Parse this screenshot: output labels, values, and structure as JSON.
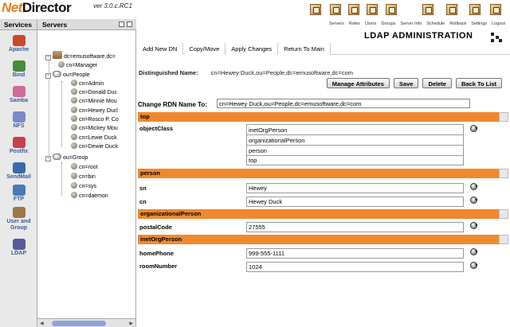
{
  "app": {
    "logo_prefix": "Net",
    "logo_suffix": "Director",
    "version": "ver 3.0.c.RC1"
  },
  "topnav": [
    "Servers",
    "Roles",
    "Users",
    "Groups",
    "Server Info",
    "Schedule",
    "Rollback",
    "Settings",
    "Logout"
  ],
  "left_panels": {
    "services": "Services",
    "servers": "Servers"
  },
  "services": [
    {
      "label": "Apache",
      "color": "#c94a2a"
    },
    {
      "label": "Bind",
      "color": "#4a8a3a"
    },
    {
      "label": "Samba",
      "color": "#d06a9a"
    },
    {
      "label": "NFS",
      "color": "#7a8ac8"
    },
    {
      "label": "Postfix",
      "color": "#c8404a"
    },
    {
      "label": "SendMail",
      "color": "#3a6aa8"
    },
    {
      "label": "FTP",
      "color": "#4a7ab8"
    },
    {
      "label": "User and Group",
      "color": "#9a7a4a"
    },
    {
      "label": "LDAP",
      "color": "#5a5a9a"
    }
  ],
  "tree": {
    "root": "dc=emusoftware,dc=",
    "manager": "cn=Manager",
    "people": "ou=People",
    "people_items": [
      "cn=Admin",
      "cn=Donald Duc",
      "cn=Minnie Mou",
      "cn=Hewey Ducl",
      "cn=Rosco P. Co",
      "cn=Mickey Mou",
      "cn=Lewie Duck",
      "cn=Dewie Duck"
    ],
    "group": "ou=Group",
    "group_items": [
      "cn=root",
      "cn=bin",
      "cn=sys",
      "cn=daemon"
    ]
  },
  "main": {
    "title": "LDAP ADMINISTRATION",
    "tabs": [
      "Add New DN",
      "Copy/Move",
      "Apply Changes",
      "Return To Main"
    ],
    "dn_label": "Distinguished Name:",
    "dn_value": "cn=Hewey Duck,ou=People,dc=emusoftware,dc=com",
    "buttons": [
      "Manage Attributes",
      "Save",
      "Delete",
      "Back To List"
    ],
    "rdn_label": "Change RDN Name To:",
    "rdn_value": "cn=Hewey Duck,ou=People,dc=emusoftware,dc=com"
  },
  "sections": {
    "top": {
      "title": "top",
      "attr": "objectClass",
      "values": [
        "inetOrgPerson",
        "organizationalPerson",
        "person",
        "top"
      ]
    },
    "person": {
      "title": "person",
      "sn_label": "sn",
      "sn_value": "Hewey",
      "cn_label": "cn",
      "cn_value": "Hewey Duck"
    },
    "orgperson": {
      "title": "organizationalPerson",
      "attr": "postalCode",
      "value": "27555"
    },
    "inetorg": {
      "title": "inetOrgPerson",
      "phone_label": "homePhone",
      "phone_value": "999-555-1111",
      "room_label": "roomNumber",
      "room_value": "1024"
    }
  },
  "colors": {
    "section": "#f0892e",
    "link": "#3a5a9a"
  }
}
